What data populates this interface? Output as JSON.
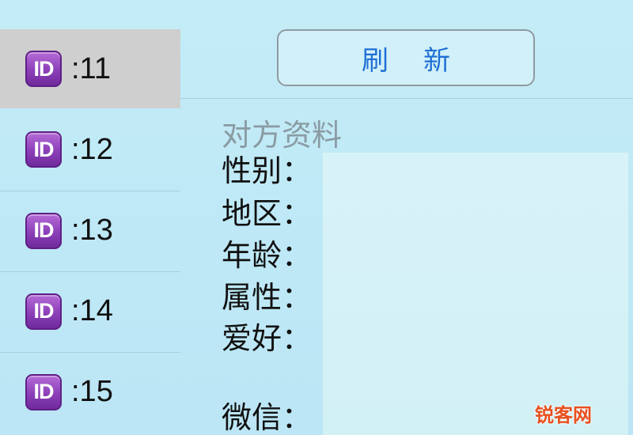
{
  "sidebar": {
    "items": [
      {
        "badge": "ID",
        "label": ":11",
        "selected": true
      },
      {
        "badge": "ID",
        "label": ":12",
        "selected": false
      },
      {
        "badge": "ID",
        "label": ":13",
        "selected": false
      },
      {
        "badge": "ID",
        "label": ":14",
        "selected": false
      },
      {
        "badge": "ID",
        "label": ":15",
        "selected": false
      }
    ]
  },
  "toolbar": {
    "refresh_label": "刷新"
  },
  "profile": {
    "title": "对方资料",
    "fields": [
      {
        "label": "性别：",
        "value": ""
      },
      {
        "label": "地区：",
        "value": ""
      },
      {
        "label": "年龄：",
        "value": ""
      },
      {
        "label": "属性：",
        "value": ""
      },
      {
        "label": "爱好：",
        "value": ""
      },
      {
        "label": "微信：",
        "value": ""
      }
    ]
  },
  "watermark": "锐客网",
  "colors": {
    "background": "#c4ecf7",
    "selected_item": "#cfcfcf",
    "badge_purple": "#8c3fb8",
    "refresh_text": "#1e6fd4",
    "title_gray": "#8a9ba3",
    "watermark": "#e8501f"
  }
}
